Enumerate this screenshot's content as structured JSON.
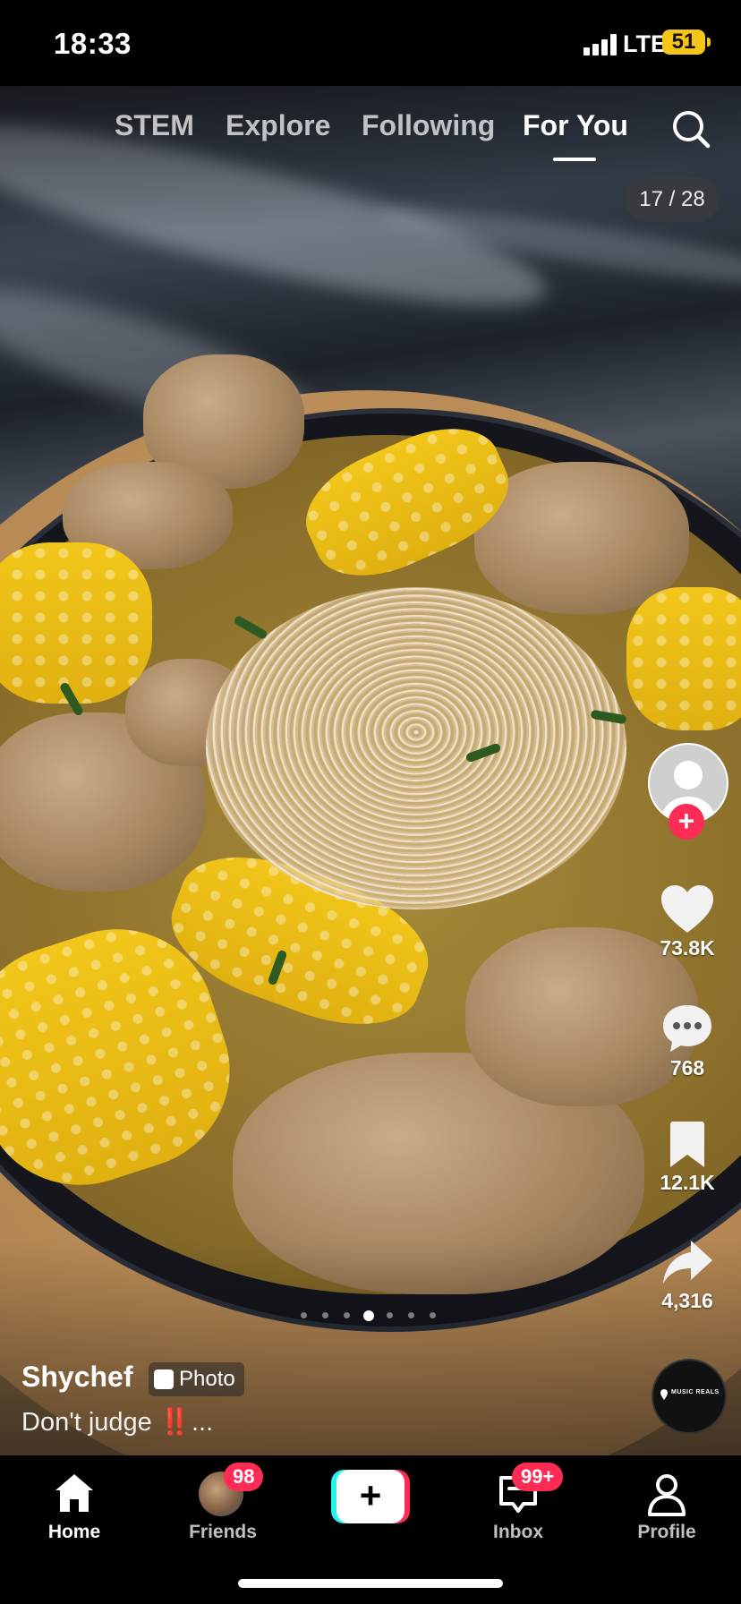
{
  "status_bar": {
    "time": "18:33",
    "network": "LTE",
    "battery": "51"
  },
  "top_nav": {
    "tabs": [
      {
        "label": "STEM"
      },
      {
        "label": "Explore"
      },
      {
        "label": "Following"
      },
      {
        "label": "For You"
      }
    ],
    "active_tab": "For You",
    "search_icon": "search-icon"
  },
  "photo_counter": "17 / 28",
  "actions": {
    "likes": "73.8K",
    "comments": "768",
    "saves": "12.1K",
    "shares": "4,316",
    "music_disc_text": "MUSIC REALS"
  },
  "carousel": {
    "total_dots": 7,
    "active_dot": 4
  },
  "caption": {
    "username": "Shychef",
    "badge": "Photo",
    "description_text": "Don't judge ",
    "description_emoji": "‼️",
    "description_more": "..."
  },
  "bottom_nav": {
    "items": [
      {
        "label": "Home",
        "icon": "home-icon"
      },
      {
        "label": "Friends",
        "icon": "friends-avatar",
        "badge": "98"
      },
      {
        "label": "",
        "icon": "create-icon",
        "symbol": "+"
      },
      {
        "label": "Inbox",
        "icon": "inbox-icon",
        "badge": "99+"
      },
      {
        "label": "Profile",
        "icon": "profile-icon"
      }
    ]
  },
  "colors": {
    "accent": "#fe2c55",
    "cyan": "#25f4ee",
    "battery": "#f5c518"
  }
}
